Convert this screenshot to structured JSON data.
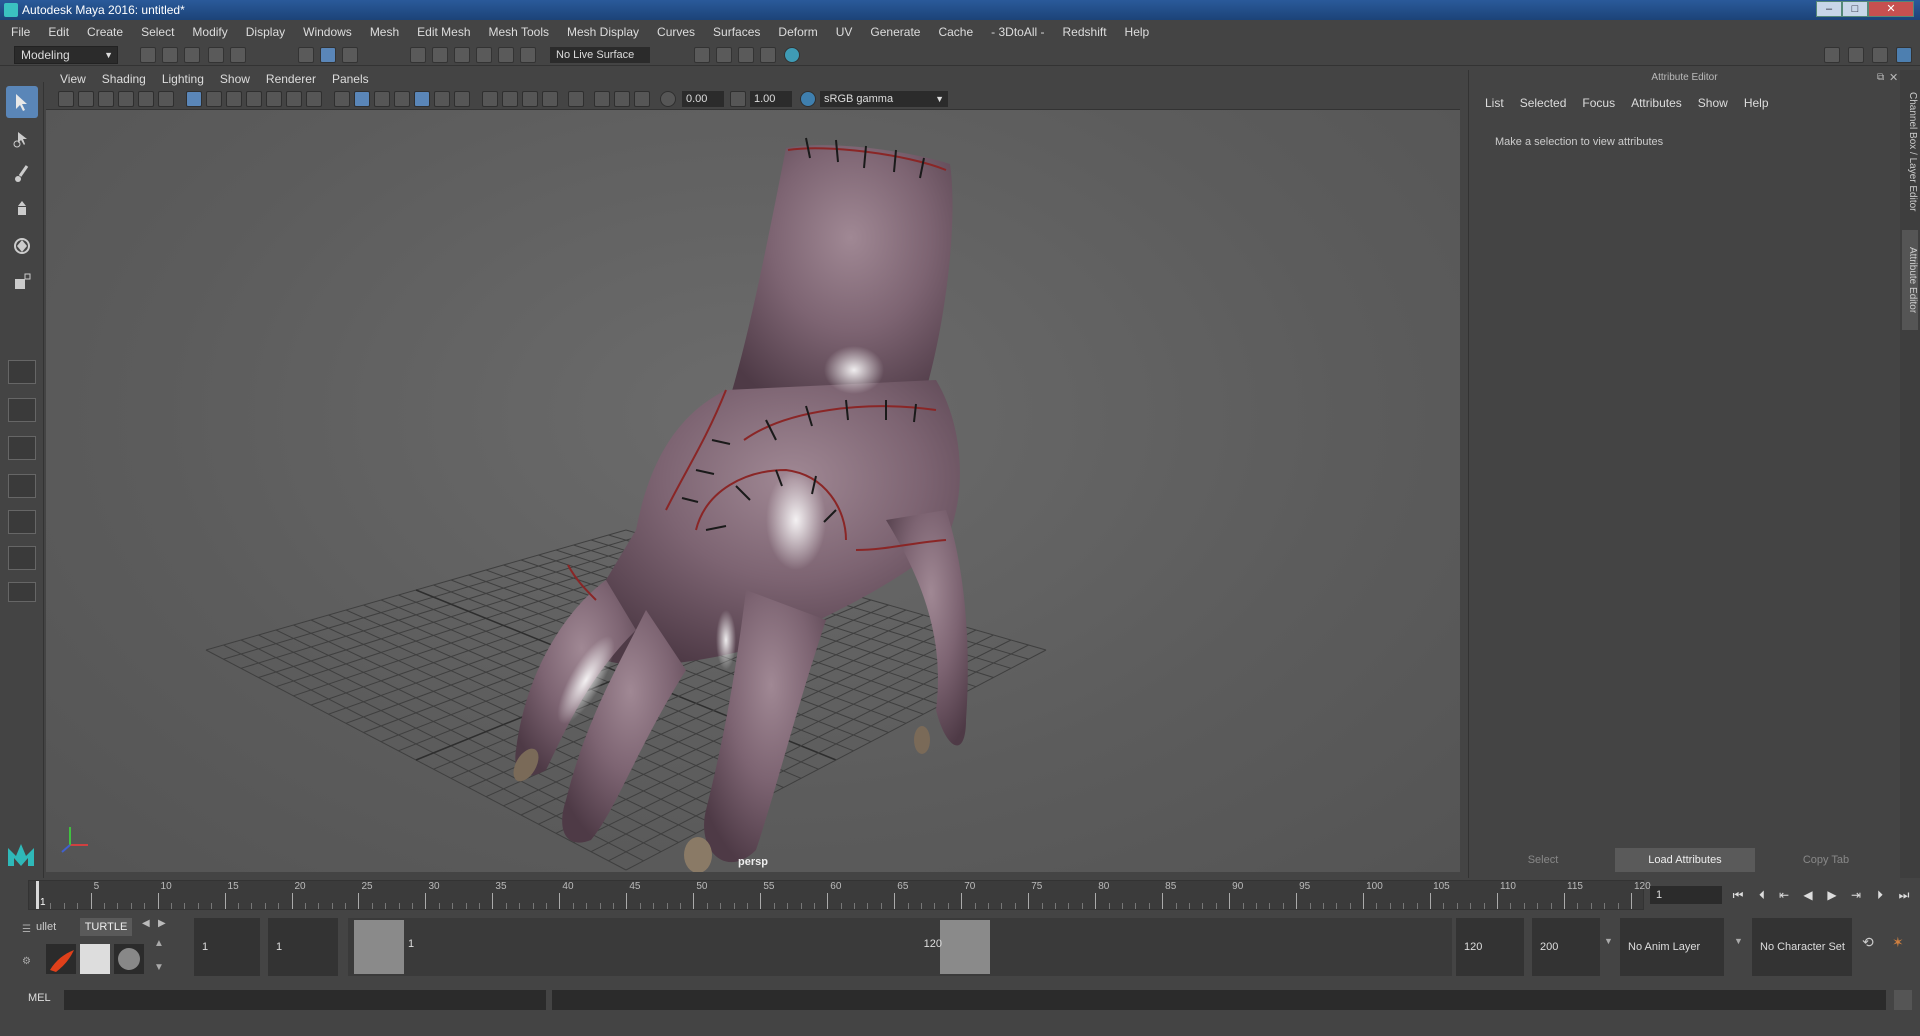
{
  "window": {
    "title": "Autodesk Maya 2016: untitled*"
  },
  "menubar": {
    "items": [
      "File",
      "Edit",
      "Create",
      "Select",
      "Modify",
      "Display",
      "Windows",
      "Mesh",
      "Edit Mesh",
      "Mesh Tools",
      "Mesh Display",
      "Curves",
      "Surfaces",
      "Deform",
      "UV",
      "Generate",
      "Cache",
      "- 3DtoAll -",
      "Redshift",
      "Help"
    ]
  },
  "statusline": {
    "mode": "Modeling",
    "live_surface": "No Live Surface"
  },
  "viewport": {
    "menu": [
      "View",
      "Shading",
      "Lighting",
      "Show",
      "Renderer",
      "Panels"
    ],
    "exposure": "0.00",
    "gamma": "1.00",
    "colorspace": "sRGB gamma",
    "camera_label": "persp"
  },
  "attribute_editor": {
    "title": "Attribute Editor",
    "menu": [
      "List",
      "Selected",
      "Focus",
      "Attributes",
      "Show",
      "Help"
    ],
    "message": "Make a selection to view attributes",
    "buttons": {
      "select": "Select",
      "load": "Load Attributes",
      "copy": "Copy Tab"
    }
  },
  "side_tabs": {
    "channel": "Channel Box / Layer Editor",
    "attribute": "Attribute Editor"
  },
  "timeline": {
    "labels": [
      "1",
      "5",
      "10",
      "15",
      "20",
      "25",
      "30",
      "35",
      "40",
      "45",
      "50",
      "55",
      "60",
      "65",
      "70",
      "75",
      "80",
      "85",
      "90",
      "95",
      "100",
      "105",
      "110",
      "115",
      "120"
    ],
    "current_frame": "1"
  },
  "range": {
    "start": "1",
    "playback_start": "1",
    "range_start_label": "1",
    "range_end_label": "120",
    "playback_end": "120",
    "end": "200",
    "anim_layer": "No Anim Layer",
    "character_set": "No Character Set",
    "shelf_tabs": [
      "ullet",
      "TURTLE"
    ]
  },
  "command_line": {
    "label": "MEL"
  },
  "colors": {
    "selection": "#5a86b8",
    "accent": "#3bc1c1",
    "grid": "#3c3c3c",
    "hand": "#7a5e6a"
  }
}
